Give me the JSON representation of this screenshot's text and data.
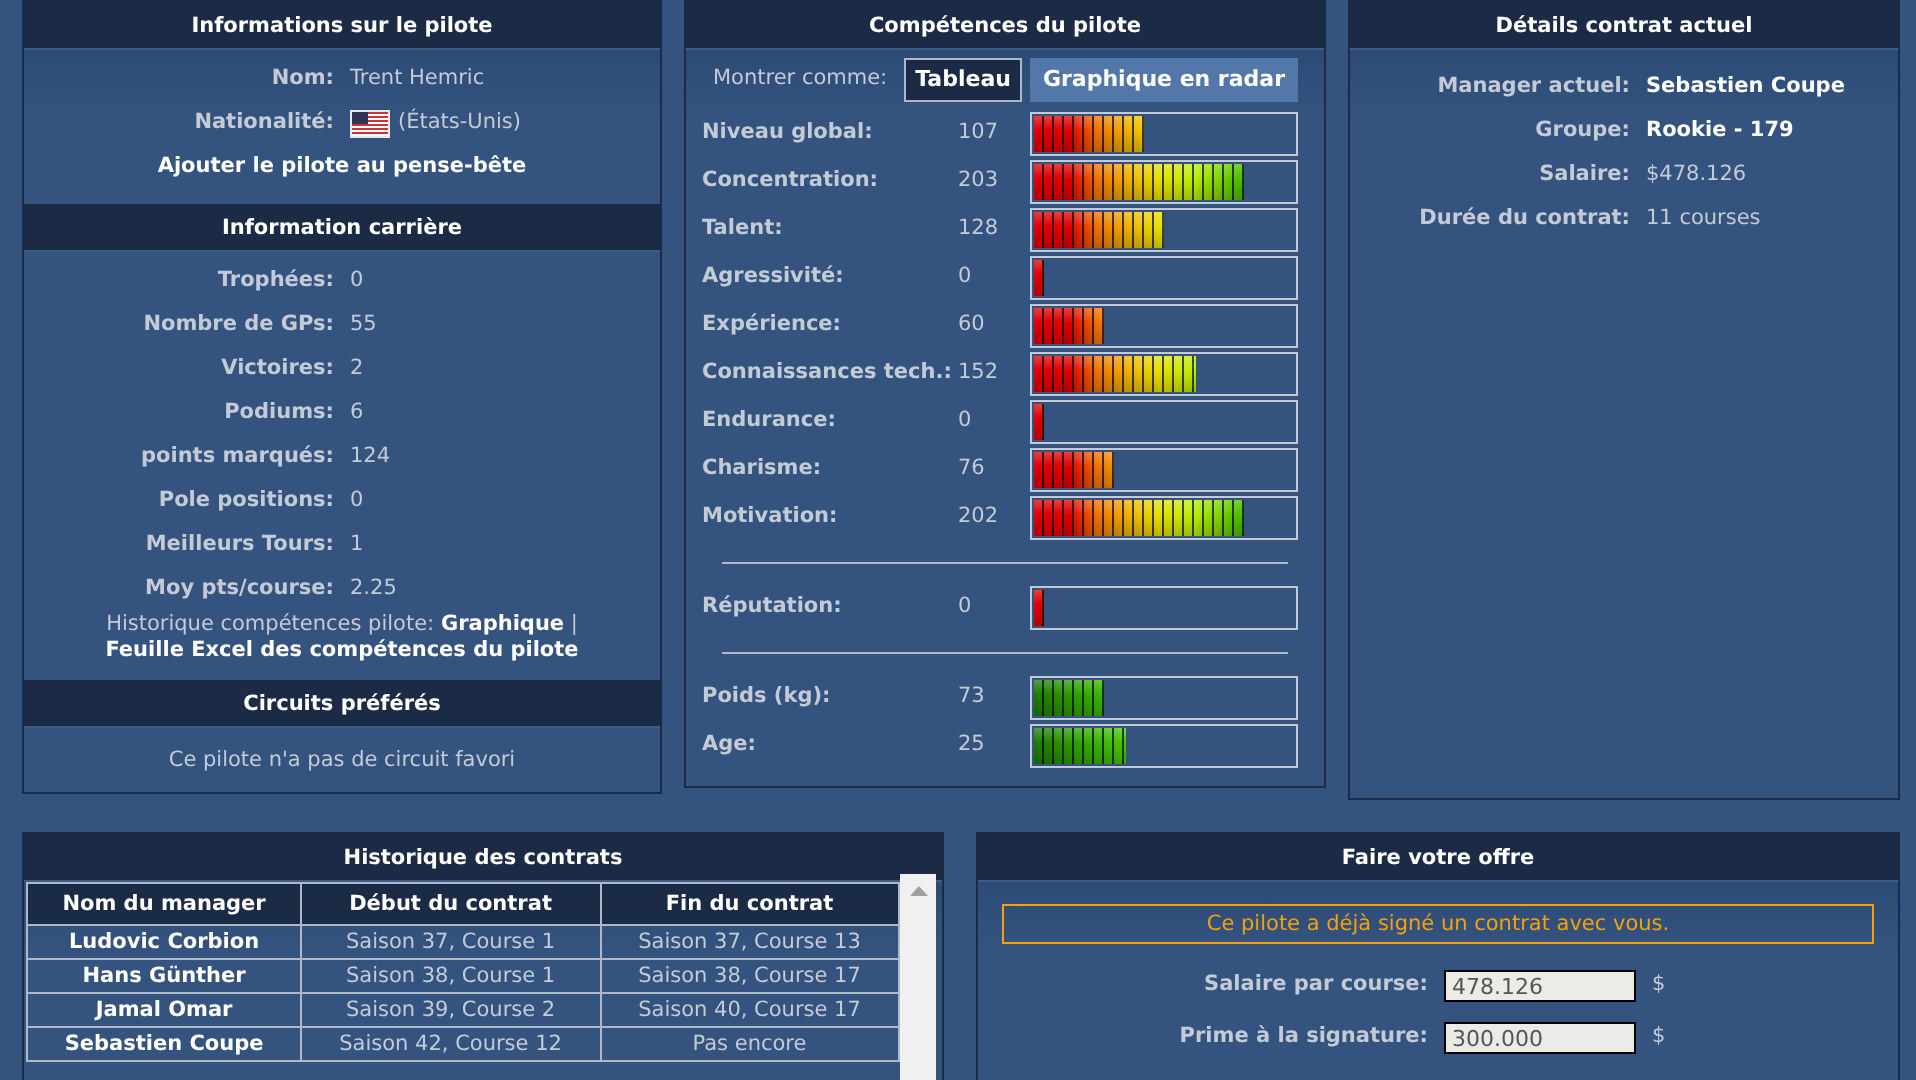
{
  "pilot_info": {
    "title": "Informations sur le pilote",
    "fields": [
      {
        "label": "Nom:",
        "value": "Trent Hemric",
        "kind": "text"
      },
      {
        "label": "Nationalité:",
        "value": "(États-Unis)",
        "kind": "flag"
      }
    ],
    "watchlist_link": "Ajouter le pilote au pense-bête"
  },
  "career": {
    "title": "Information carrière",
    "stats": [
      {
        "label": "Trophées:",
        "value": "0"
      },
      {
        "label": "Nombre de GPs:",
        "value": "55"
      },
      {
        "label": "Victoires:",
        "value": "2"
      },
      {
        "label": "Podiums:",
        "value": "6"
      },
      {
        "label": "points marqués:",
        "value": "124"
      },
      {
        "label": "Pole positions:",
        "value": "0"
      },
      {
        "label": "Meilleurs Tours:",
        "value": "1"
      },
      {
        "label": "Moy pts/course:",
        "value": "2.25"
      }
    ],
    "history_label": "Historique compétences pilote:",
    "links": [
      "Graphique",
      "Feuille Excel des compétences du pilote"
    ],
    "separator": "|"
  },
  "favorite_circuits": {
    "title": "Circuits préférés",
    "message": "Ce pilote n'a pas de circuit favori"
  },
  "skills": {
    "title": "Compétences du pilote",
    "show_as_label": "Montrer comme:",
    "views": [
      {
        "label": "Tableau",
        "selected": true
      },
      {
        "label": "Graphique en radar",
        "selected": false
      }
    ],
    "groups": [
      [
        {
          "label": "Niveau global:",
          "value": "107",
          "level": 0.42,
          "kind": "skill"
        },
        {
          "label": "Concentration:",
          "value": "203",
          "level": 0.81,
          "kind": "skill"
        },
        {
          "label": "Talent:",
          "value": "128",
          "level": 0.5,
          "kind": "skill"
        },
        {
          "label": "Agressivité:",
          "value": "0",
          "level": 0.04,
          "kind": "skill"
        },
        {
          "label": "Expérience:",
          "value": "60",
          "level": 0.27,
          "kind": "skill"
        },
        {
          "label": "Connaissances tech.:",
          "value": "152",
          "level": 0.62,
          "kind": "skill"
        },
        {
          "label": "Endurance:",
          "value": "0",
          "level": 0.04,
          "kind": "skill"
        },
        {
          "label": "Charisme:",
          "value": "76",
          "level": 0.31,
          "kind": "skill"
        },
        {
          "label": "Motivation:",
          "value": "202",
          "level": 0.81,
          "kind": "skill"
        }
      ],
      [
        {
          "label": "Réputation:",
          "value": "0",
          "level": 0.04,
          "kind": "skill"
        }
      ],
      [
        {
          "label": "Poids (kg):",
          "value": "73",
          "level": 0.27,
          "kind": "physical"
        },
        {
          "label": "Age:",
          "value": "25",
          "level": 0.35,
          "kind": "physical"
        }
      ]
    ]
  },
  "contract": {
    "title": "Détails contrat actuel",
    "fields": [
      {
        "label": "Manager actuel:",
        "value": "Sebastien Coupe",
        "emphasis": true
      },
      {
        "label": "Groupe:",
        "value": "Rookie - 179",
        "emphasis": true
      },
      {
        "label": "Salaire:",
        "value": "$478.126",
        "emphasis": false
      },
      {
        "label": "Durée du contrat:",
        "value": "11 courses",
        "emphasis": false
      }
    ]
  },
  "history": {
    "title": "Historique des contrats",
    "columns": [
      "Nom du manager",
      "Début du contrat",
      "Fin du contrat"
    ],
    "rows": [
      [
        "Ludovic Corbion",
        "Saison 37, Course 1",
        "Saison 37, Course 13"
      ],
      [
        "Hans Günther",
        "Saison 38, Course 1",
        "Saison 38, Course 17"
      ],
      [
        "Jamal Omar",
        "Saison 39, Course 2",
        "Saison 40, Course 17"
      ],
      [
        "Sebastien Coupe",
        "Saison 42, Course 12",
        "Pas encore"
      ]
    ]
  },
  "offer": {
    "title": "Faire votre offre",
    "notice": "Ce pilote a déjà signé un contrat avec vous.",
    "fields": [
      {
        "label": "Salaire par course:",
        "value": "478.126",
        "unit": "$"
      },
      {
        "label": "Prime à la signature:",
        "value": "300.000",
        "unit": "$"
      }
    ]
  }
}
